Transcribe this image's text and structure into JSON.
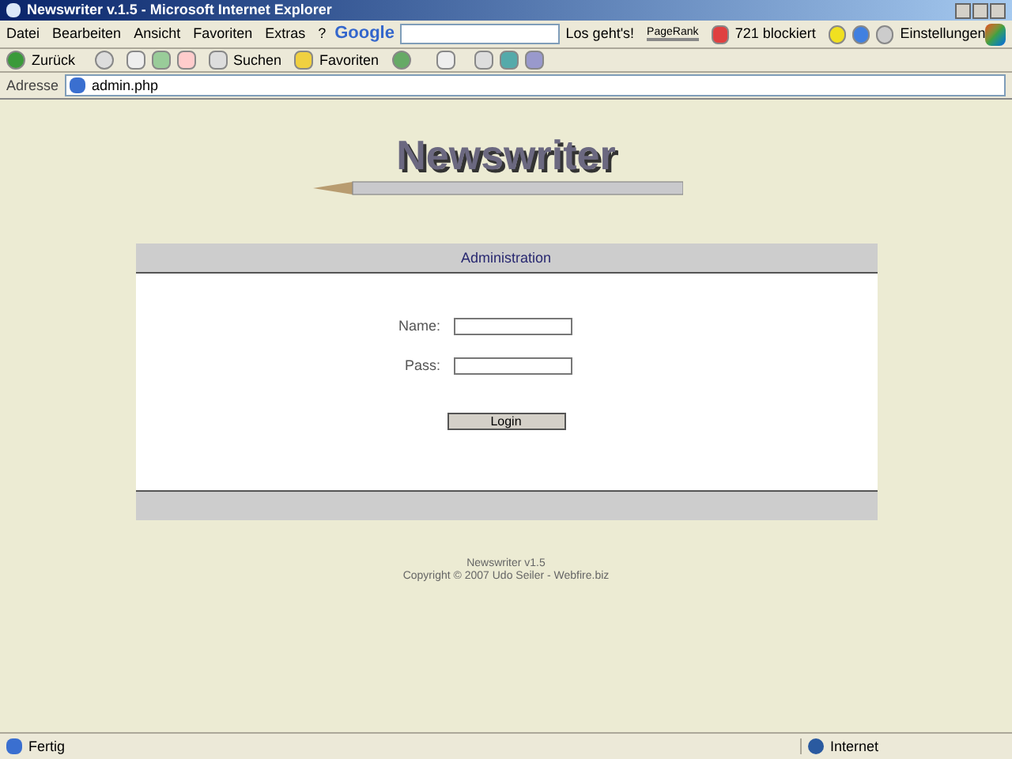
{
  "window": {
    "title": "Newswriter v.1.5 - Microsoft Internet Explorer"
  },
  "menu": [
    "Datei",
    "Bearbeiten",
    "Ansicht",
    "Favoriten",
    "Extras",
    "?"
  ],
  "google_toolbar": {
    "logo": "Google",
    "go_button": "Los geht's!",
    "pagerank": "PageRank",
    "popups": "721 blockiert",
    "settings": "Einstellungen"
  },
  "toolbar": {
    "back": "Zurück",
    "search": "Suchen",
    "favorites": "Favoriten"
  },
  "address": {
    "label": "Adresse",
    "value": "admin.php"
  },
  "page": {
    "logo": "Newswriter",
    "panel_title": "Administration",
    "fields": [
      {
        "label": "Name:"
      },
      {
        "label": "Pass:"
      }
    ],
    "button": "Login",
    "footer": [
      "Newswriter v1.5",
      "Copyright © 2007 Udo Seiler - Webfire.biz"
    ]
  },
  "status_bar": {
    "text": "Fertig",
    "zone": "Internet"
  }
}
